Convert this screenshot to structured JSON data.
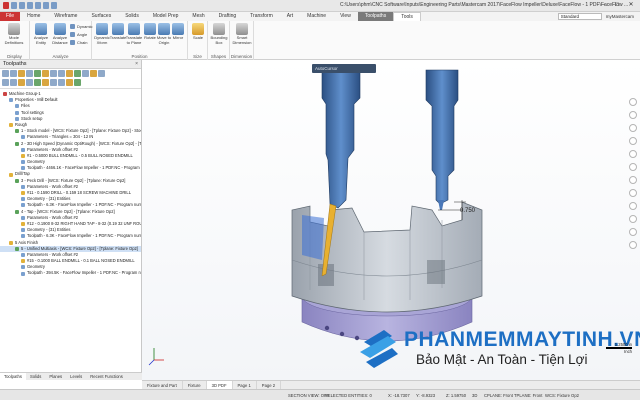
{
  "titlebar": {
    "title": "C:\\Users\\phm\\CNC Software\\Inputs\\Engineering Parts\\Mastercam 2017\\FaceFlow Impeller\\Deluxe\\FaceFlow - 1 PDF\\FaceFlow ..."
  },
  "tabs": {
    "items": [
      "File",
      "Home",
      "Wireframe",
      "Surfaces",
      "Solids",
      "Model Prep",
      "Mesh",
      "Drafting",
      "Transform",
      "Art",
      "Machine",
      "View",
      "Toolpaths",
      "Tools"
    ],
    "active": "Tools",
    "standard": "Standard",
    "user": "myMastercam"
  },
  "ribbon": {
    "groups": [
      {
        "label": "Display",
        "buttons": [
          "Mode Definitions"
        ]
      },
      {
        "label": "Analyze",
        "buttons": [
          "Analyze Entity",
          "Analyze Distance"
        ],
        "small": [
          "Dynamic",
          "Angle",
          "Chain"
        ]
      },
      {
        "label": "Position",
        "buttons": [
          "Dynamic Xform",
          "Translate",
          "Translate to Plane",
          "Rotate",
          "Move to Origin",
          "Mirror"
        ]
      },
      {
        "label": "Size",
        "buttons": [
          "Scale"
        ]
      },
      {
        "label": "Shapes",
        "buttons": [
          "Bounding Box"
        ]
      },
      {
        "label": "Dimension",
        "buttons": [
          "Smart Dimension"
        ]
      }
    ]
  },
  "panel": {
    "title": "Toolpaths",
    "close": "×",
    "tree": [
      {
        "text": "Machine Group-1",
        "indent": 0,
        "icon": "r"
      },
      {
        "text": "Properties - Mill Default",
        "indent": 1,
        "icon": "b"
      },
      {
        "text": "Files",
        "indent": 2,
        "icon": "b"
      },
      {
        "text": "Tool settings",
        "indent": 2,
        "icon": "b"
      },
      {
        "text": "Stock setup",
        "indent": 2,
        "icon": "b"
      },
      {
        "text": "Rough",
        "indent": 1,
        "icon": "y"
      },
      {
        "text": "1 - Stock model - [WCS: Fixture Op2] - [Tplane: Fixture Op2] - Stock",
        "indent": 2,
        "icon": "gr"
      },
      {
        "text": "Parameters - Triangles = 304 - 12 IN",
        "indent": 3,
        "icon": "b"
      },
      {
        "text": "2 - 3D High Speed (Dynamic OptiRough) - [WCS: Fixture Op2] - [Tplane",
        "indent": 2,
        "icon": "gr"
      },
      {
        "text": "Parameters - Work offset #2",
        "indent": 3,
        "icon": "b"
      },
      {
        "text": "#1 - 0.5000 BULL ENDMILL - 0.5 BULL NOSED ENDMILL",
        "indent": 3,
        "icon": "y"
      },
      {
        "text": "Geometry",
        "indent": 3,
        "icon": "b"
      },
      {
        "text": "Toolpath - 4466.1K - FaceFlow Impeller - 1 PDF.NC - Program num",
        "indent": 3,
        "icon": "b"
      },
      {
        "text": "Drill/Tap",
        "indent": 1,
        "icon": "y"
      },
      {
        "text": "3 - Peck Drill - [WCS: Fixture Op2] - [Tplane: Fixture Op2]",
        "indent": 2,
        "icon": "gr"
      },
      {
        "text": "Parameters - Work offset #2",
        "indent": 3,
        "icon": "b"
      },
      {
        "text": "#11 - 0.1590 DRILL - 0.159 18 SCREW MACHINE DRILL",
        "indent": 3,
        "icon": "y"
      },
      {
        "text": "Geometry - (31) Entities",
        "indent": 3,
        "icon": "b"
      },
      {
        "text": "Toolpath - 6.3K - FaceFlow Impeller - 1 PDF.NC - Program number",
        "indent": 3,
        "icon": "b"
      },
      {
        "text": "4 - Tap - [WCS: Fixture Op2] - [Tplane: Fixture Op2]",
        "indent": 2,
        "icon": "gr"
      },
      {
        "text": "Parameters - Work offset #2",
        "indent": 3,
        "icon": "b"
      },
      {
        "text": "#12 - 0.1900 8-32 RIGHT HAND TAP - 8-32 (0.19 32 UNF ROUGH)",
        "indent": 3,
        "icon": "y"
      },
      {
        "text": "Geometry - (31) Entities",
        "indent": 3,
        "icon": "b"
      },
      {
        "text": "Toolpath - 6.3K - FaceFlow Impeller - 1 PDF.NC - Program number",
        "indent": 3,
        "icon": "b"
      },
      {
        "text": "5 Axis Finish",
        "indent": 1,
        "icon": "y"
      },
      {
        "text": "5 - Unified Multiaxis - [WCS: Fixture Op2] - [Tplane: Fixture Op2]",
        "indent": 2,
        "icon": "gr",
        "selected": true
      },
      {
        "text": "Parameters - Work offset #2",
        "indent": 3,
        "icon": "b"
      },
      {
        "text": "#15 - 0.1000 BALL ENDMILL - 0.1 BALL NOSED ENDMILL",
        "indent": 3,
        "icon": "y"
      },
      {
        "text": "Geometry",
        "indent": 3,
        "icon": "b"
      },
      {
        "text": "Toolpath - 394.5K - FaceFlow Impeller - 1 PDF.NC - Program num",
        "indent": 3,
        "icon": "b"
      }
    ],
    "bottom_tabs": [
      "Toolpaths",
      "Solids",
      "Planes",
      "Levels",
      "Recent Functions"
    ]
  },
  "viewport": {
    "toolbar_label": "AutoCursor",
    "dimension_label": "0.750",
    "scale_value": "1.2500 in",
    "scale_unit": "Inch",
    "watermark_brand": "PHANMEMMAYTINH.VN",
    "watermark_tagline": "Bảo Mật - An Toàn - Tiện Lợi",
    "colors": {
      "part": "#c6ccd4",
      "tool_holder": "#3c6aa6",
      "tool_tip": "#e8b030",
      "accent": "#1d6fc4"
    }
  },
  "view_tabs": [
    "Fixture and Part",
    "Fixture",
    "3D PDF",
    "Page 1",
    "Page 2"
  ],
  "view_tabs_active": "3D PDF",
  "status": {
    "section": "SECTION VIEW: OFF",
    "selected": "SELECTED ENTITIES: 0",
    "x": "X: -18.7307",
    "y": "Y: -8.9323",
    "z": "Z: 1.59750",
    "dim": "3D",
    "cplane": "CPLANE: Front",
    "tplane": "TPLANE: Front",
    "wcs": "WCS: Fixture Op2"
  }
}
